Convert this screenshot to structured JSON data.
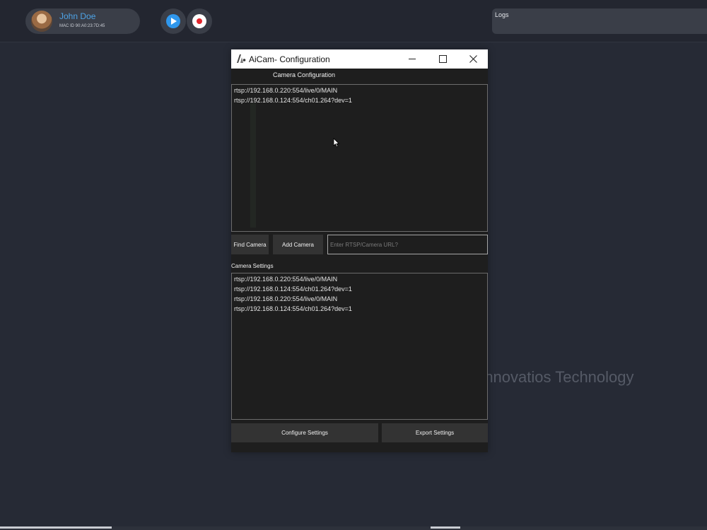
{
  "header": {
    "user_name": "John Doe",
    "mac_id": "MAC ID 90:A0:23:7D:45",
    "avatar": "avatar",
    "play_icon": "play-icon",
    "record_icon": "record-icon",
    "logs_label": "Logs"
  },
  "window": {
    "title": "AiCam- Configuration",
    "app_icon": "aicam-logo-icon",
    "controls": [
      "minimize-icon",
      "maximize-icon",
      "close-icon"
    ],
    "camera_configuration_title": "Camera Configuration",
    "camera_list": [
      "rtsp://192.168.0.220:554/live/0/MAIN",
      "rtsp://192.168.0.124:554/ch01.264?dev=1"
    ],
    "find_camera_label": "Find Camera",
    "add_camera_label": "Add Camera",
    "url_placeholder": "Enter RTSP/Camera URL?",
    "url_value": "",
    "camera_settings_label": "Camera Settings",
    "settings_list": [
      "rtsp://192.168.0.220:554/live/0/MAIN",
      "rtsp://192.168.0.124:554/ch01.264?dev=1",
      "rtsp://192.168.0.220:554/live/0/MAIN",
      "rtsp://192.168.0.124:554/ch01.264?dev=1"
    ],
    "configure_settings_label": "Configure Settings",
    "export_settings_label": "Export Settings"
  },
  "watermark": "©Innovatios Technology",
  "colors": {
    "background": "#262a35",
    "accent_blue": "#2f97ec",
    "record_red": "#e2262d",
    "window_bg": "#1e1e1e",
    "button_bg": "#333333"
  }
}
